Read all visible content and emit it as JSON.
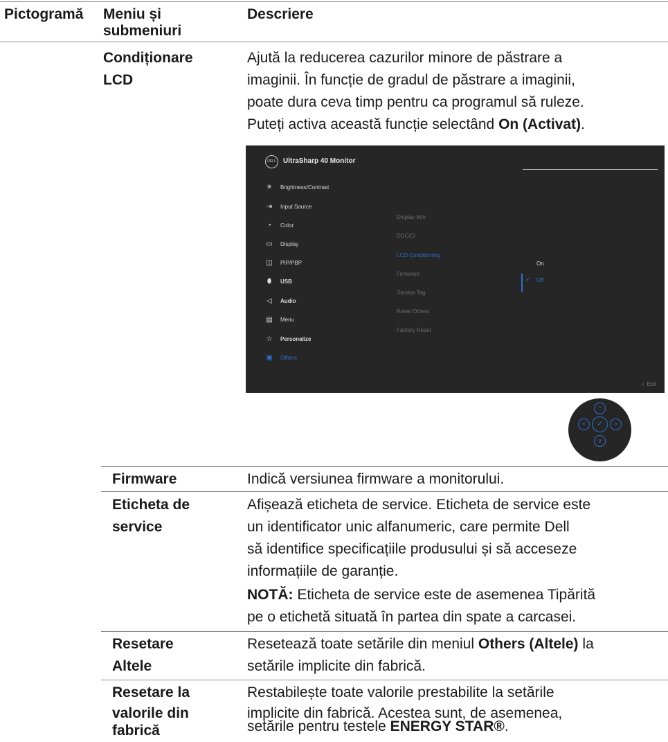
{
  "header": {
    "col_icon": "Pictogramă",
    "col_menu_line1": "Meniu și",
    "col_menu_line2": "submeniuri",
    "col_desc": "Descriere"
  },
  "rows": {
    "lcd": {
      "name_line1": "Condiționare",
      "name_line2": "LCD",
      "desc_line1": "Ajută la reducerea cazurilor minore de păstrare a",
      "desc_line2": "imaginii. În funcție de gradul de păstrare a imaginii,",
      "desc_line3": "poate dura ceva timp pentru ca programul să ruleze.",
      "desc_line4_pre": "Puteți activa această funcție selectând ",
      "desc_line4_bold": "On (Activat)",
      "desc_line4_post": "."
    },
    "firmware": {
      "name": "Firmware",
      "desc": "Indică versiunea firmware a monitorului."
    },
    "service_tag": {
      "name_line1": "Eticheta de",
      "name_line2": "service",
      "desc_line1": "Afișează eticheta de service. Eticheta de service este",
      "desc_line2": "un identificator unic alfanumeric, care permite Dell",
      "desc_line3": "să identifice specificațiile produsului și să acceseze",
      "desc_line4": "informațiile de garanție.",
      "note_bold": "NOTĂ:",
      "note_line1_rest": " Eticheta de service este de asemenea Tipărită",
      "note_line2": "pe o etichetă situată în partea din spate a carcasei."
    },
    "reset_others": {
      "name_line1": "Resetare",
      "name_line2": "Altele",
      "desc_line1_pre": "Resetează toate setările din meniul ",
      "desc_line1_bold": "Others (Altele)",
      "desc_line1_post": " la",
      "desc_line2": "setările implicite din fabrică."
    },
    "factory_reset": {
      "name_line1": "Resetare la",
      "name_line2": "valorile din",
      "name_line3": "fabrică",
      "desc_line1": "Restabilește toate valorile prestabilite la setările",
      "desc_line2": "implicite din fabrică. Acestea sunt, de asemenea,",
      "desc_line3_pre": "setările pentru  testele ",
      "desc_line3_bold": "ENERGY STAR®",
      "desc_line3_post": "."
    }
  },
  "osd": {
    "logo_text": "DELL",
    "title": "UltraSharp 40 Monitor",
    "menu": [
      {
        "label": "Brightness/Contrast",
        "icon": "sun-icon"
      },
      {
        "label": "Input Source",
        "icon": "input-source-icon"
      },
      {
        "label": "Color",
        "icon": "palette-icon"
      },
      {
        "label": "Display",
        "icon": "display-icon"
      },
      {
        "label": "PIP/PBP",
        "icon": "pip-icon"
      },
      {
        "label": "USB",
        "icon": "mouse-icon"
      },
      {
        "label": "Audio",
        "icon": "speaker-icon"
      },
      {
        "label": "Menu",
        "icon": "menu-icon"
      },
      {
        "label": "Personalize",
        "icon": "star-icon"
      },
      {
        "label": "Others",
        "icon": "others-icon"
      }
    ],
    "submenu": [
      "Display Info",
      "DDC/CI",
      "LCD Conditioning",
      "Firmware",
      "Service Tag",
      "Reset Others",
      "Factory Reset"
    ],
    "options": [
      "On",
      "Off"
    ],
    "exit_label": "Exit",
    "accent_color": "#2f6fd0",
    "background_color": "#262626"
  },
  "joystick": {
    "up": "up-arrow-icon",
    "down": "down-arrow-icon",
    "left": "left-arrow-icon",
    "right": "right-arrow-icon",
    "center": "check-icon"
  }
}
